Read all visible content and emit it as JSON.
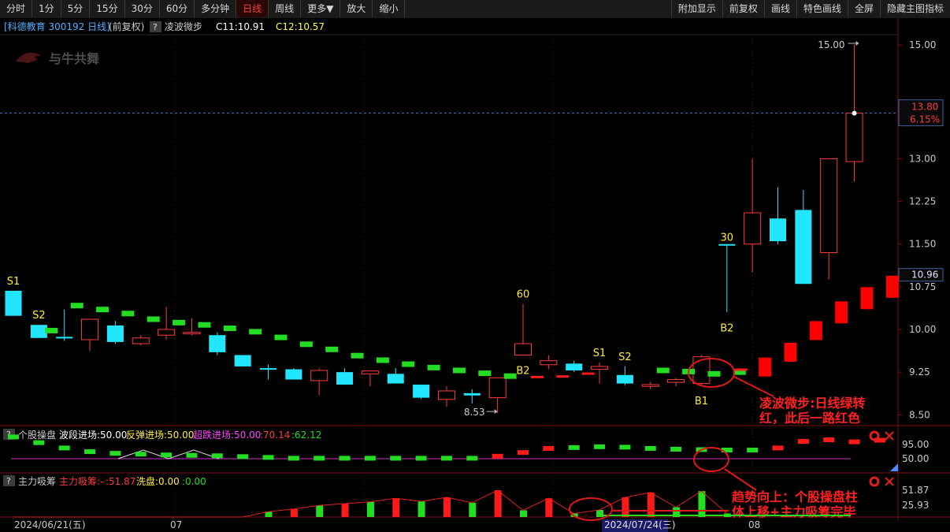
{
  "toolbar": {
    "left": [
      "分时",
      "1分",
      "5分",
      "15分",
      "30分",
      "60分",
      "多分钟",
      "日线",
      "周线",
      "更多▼",
      "放大",
      "缩小"
    ],
    "active": "日线",
    "right": [
      "附加显示",
      "前复权",
      "画线",
      "特色画线",
      "全屏",
      "隐藏主图指标"
    ]
  },
  "header": {
    "stock": "[科德教育  300192 日线]",
    "adjust": "(前复权)",
    "q": "?",
    "indicator": "凌波微步",
    "c1": "C11:10.91",
    "c2": "C12:10.57"
  },
  "logo_text": "与牛共舞",
  "price_axis": {
    "ticks": [
      "15.00",
      "13.00",
      "12.25",
      "11.50",
      "10.75",
      "10.00",
      "9.25",
      "8.50"
    ],
    "tick_values": [
      15.0,
      13.0,
      12.25,
      11.5,
      10.75,
      10.0,
      9.25,
      8.5
    ],
    "price_box": "13.80",
    "pct_box": "6.15%",
    "last_box": "10.96"
  },
  "chart_data": {
    "type": "candlestick",
    "x_start": "2024/06/21",
    "candles": [
      {
        "o": 10.68,
        "c": 10.24,
        "h": 10.68,
        "l": 10.24
      },
      {
        "o": 10.08,
        "c": 9.85,
        "h": 10.08,
        "l": 9.85
      },
      {
        "o": 9.87,
        "c": 9.85,
        "h": 10.35,
        "l": 9.8
      },
      {
        "o": 9.82,
        "c": 10.18,
        "h": 10.18,
        "l": 9.62
      },
      {
        "o": 10.07,
        "c": 9.78,
        "h": 10.15,
        "l": 9.75
      },
      {
        "o": 9.75,
        "c": 9.85,
        "h": 9.9,
        "l": 9.72
      },
      {
        "o": 9.9,
        "c": 10.0,
        "h": 10.4,
        "l": 9.82
      },
      {
        "o": 9.93,
        "c": 9.95,
        "h": 10.2,
        "l": 9.9
      },
      {
        "o": 9.9,
        "c": 9.6,
        "h": 9.95,
        "l": 9.55
      },
      {
        "o": 9.55,
        "c": 9.35,
        "h": 9.55,
        "l": 9.35
      },
      {
        "o": 9.32,
        "c": 9.3,
        "h": 9.38,
        "l": 9.12
      },
      {
        "o": 9.3,
        "c": 9.12,
        "h": 9.32,
        "l": 9.12
      },
      {
        "o": 9.1,
        "c": 9.28,
        "h": 9.32,
        "l": 8.85
      },
      {
        "o": 9.25,
        "c": 9.03,
        "h": 9.32,
        "l": 9.03
      },
      {
        "o": 9.22,
        "c": 9.27,
        "h": 9.27,
        "l": 9.0
      },
      {
        "o": 9.22,
        "c": 9.05,
        "h": 9.32,
        "l": 9.05
      },
      {
        "o": 9.03,
        "c": 8.8,
        "h": 9.03,
        "l": 8.78
      },
      {
        "o": 8.77,
        "c": 8.92,
        "h": 9.0,
        "l": 8.64
      },
      {
        "o": 8.88,
        "c": 8.84,
        "h": 8.95,
        "l": 8.7
      },
      {
        "o": 8.8,
        "c": 9.15,
        "h": 9.15,
        "l": 8.53
      },
      {
        "o": 9.55,
        "c": 9.75,
        "h": 10.45,
        "l": 9.55
      },
      {
        "o": 9.38,
        "c": 9.45,
        "h": 9.55,
        "l": 9.3
      },
      {
        "o": 9.4,
        "c": 9.28,
        "h": 9.45,
        "l": 9.25
      },
      {
        "o": 9.3,
        "c": 9.35,
        "h": 9.42,
        "l": 9.05
      },
      {
        "o": 9.2,
        "c": 9.05,
        "h": 9.35,
        "l": 9.02
      },
      {
        "o": 9.0,
        "c": 9.03,
        "h": 9.08,
        "l": 8.95
      },
      {
        "o": 9.07,
        "c": 9.12,
        "h": 9.15,
        "l": 9.0
      },
      {
        "o": 9.05,
        "c": 9.52,
        "h": 9.55,
        "l": 9.02
      },
      {
        "o": 11.5,
        "c": 11.5,
        "h": 11.45,
        "l": 10.3
      },
      {
        "o": 11.5,
        "c": 12.05,
        "h": 13.0,
        "l": 11.0
      },
      {
        "o": 11.95,
        "c": 11.55,
        "h": 12.5,
        "l": 11.5
      },
      {
        "o": 12.1,
        "c": 10.8,
        "h": 12.45,
        "l": 10.8
      },
      {
        "o": 11.35,
        "c": 13.0,
        "h": 13.0,
        "l": 10.88
      },
      {
        "o": 12.95,
        "c": 13.8,
        "h": 15.0,
        "l": 12.6
      }
    ],
    "trail": [
      null,
      9.98,
      10.42,
      10.35,
      10.28,
      10.18,
      10.12,
      10.08,
      10.02,
      9.96,
      9.86,
      9.74,
      9.65,
      9.54,
      9.46,
      9.39,
      9.33,
      9.28,
      9.23,
      9.18,
      null,
      null,
      null,
      null,
      null,
      9.28,
      9.26,
      9.22,
      9.25,
      9.34,
      9.6,
      9.98,
      10.3,
      10.55,
      10.75
    ],
    "signals": [
      {
        "i": 0,
        "text": "S1",
        "pos": "above",
        "val": 10.68
      },
      {
        "i": 1,
        "text": "S2",
        "pos": "above",
        "val": 10.08
      },
      {
        "i": 20,
        "text": "60",
        "pos": "above",
        "val": 10.45
      },
      {
        "i": 20,
        "text": "B2",
        "pos": "below",
        "val": 9.55
      },
      {
        "i": 23,
        "text": "S1",
        "pos": "above",
        "val": 9.42
      },
      {
        "i": 24,
        "text": "S2",
        "pos": "above",
        "val": 9.35
      },
      {
        "i": 27,
        "text": "B1",
        "pos": "below",
        "val": 9.02
      },
      {
        "i": 28,
        "text": "30",
        "pos": "above",
        "val": 11.45
      },
      {
        "i": 28,
        "text": "B2",
        "pos": "below",
        "val": 10.3
      }
    ],
    "high_label": "15.00",
    "low_label": "8.53"
  },
  "annotation1": [
    "凌波微步:日线绿转",
    "红，此后一路红色"
  ],
  "annotation2": [
    "趋势向上：个股操盘柱",
    "体上移+主力吸筹完毕"
  ],
  "panel1": {
    "q": "?",
    "name": "个股操盘",
    "a_label": "波段进场:50.00",
    "b_label": "反弹进场:50.00",
    "c_label": "超跌进场:50.00",
    "d_label": ":70.14",
    "e_label": ":62.12",
    "ticks": [
      "95.00",
      "50.00"
    ],
    "values": [
      82,
      68,
      55,
      46,
      42,
      40,
      38,
      37,
      36,
      34,
      32,
      30,
      30,
      30,
      30,
      30,
      30,
      30,
      30,
      35,
      44,
      54,
      56,
      58,
      57,
      54,
      52,
      51,
      50,
      50,
      55,
      71,
      75,
      70,
      74
    ]
  },
  "panel2": {
    "q": "?",
    "name": "主力吸筹",
    "a_label": "主力吸筹:-",
    "b_label": ":51.87",
    "c_label": "洗盘:0.00",
    "d_label": ":0.00",
    "ticks": [
      "51.87",
      "25.93"
    ],
    "values": [
      0,
      0,
      0,
      0,
      0,
      0,
      0,
      0,
      0,
      0,
      12,
      18,
      26,
      30,
      34,
      42,
      35,
      44,
      32,
      60,
      15,
      42,
      8,
      16,
      44,
      55,
      22,
      58,
      8,
      0,
      0,
      0,
      0,
      0,
      0,
      0,
      0,
      0
    ]
  },
  "date_axis": {
    "first": "2024/06/21(五)",
    "m07": "07",
    "mid": "2024/07/24(三)",
    "m08": "08"
  }
}
